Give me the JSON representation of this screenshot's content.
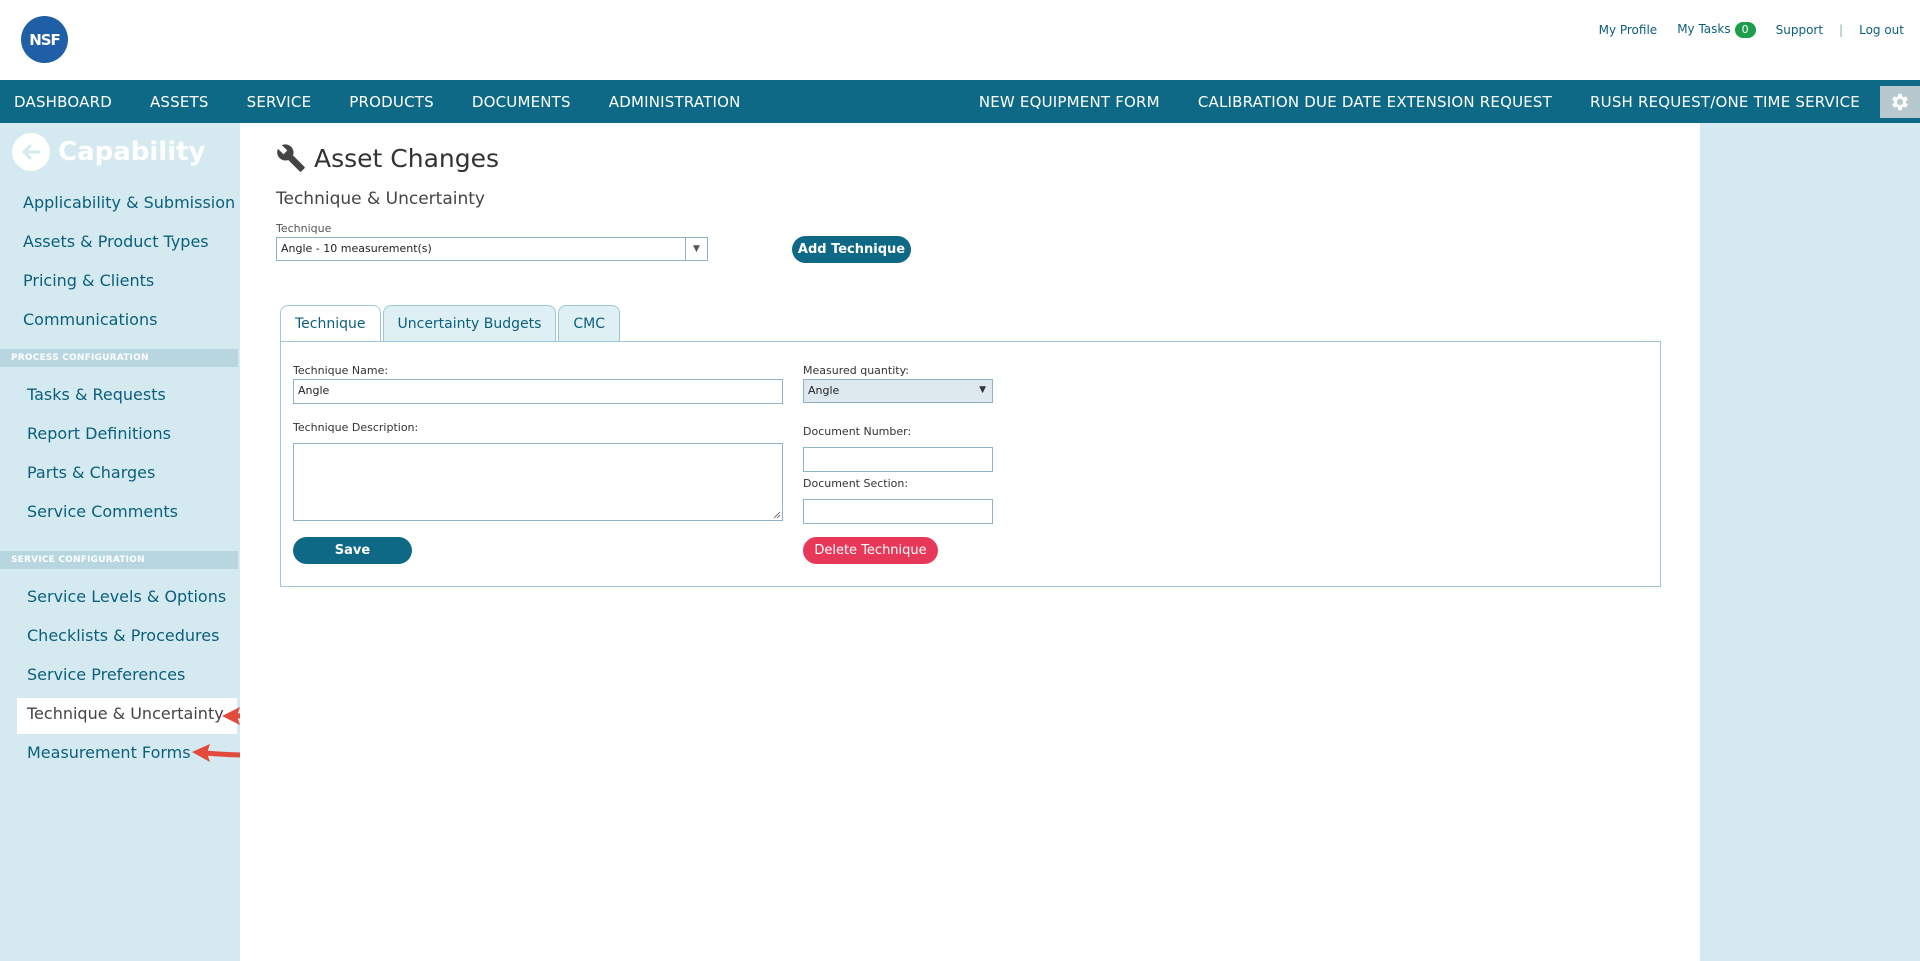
{
  "brand": {
    "logo_text": "NSF"
  },
  "top_links": {
    "my_profile": "My Profile",
    "my_tasks": "My Tasks",
    "tasks_count": "0",
    "support": "Support",
    "separator": "|",
    "log_out": "Log out"
  },
  "nav": {
    "left": [
      "DASHBOARD",
      "ASSETS",
      "SERVICE",
      "PRODUCTS",
      "DOCUMENTS",
      "ADMINISTRATION"
    ],
    "right": [
      "NEW EQUIPMENT FORM",
      "CALIBRATION DUE DATE EXTENSION REQUEST",
      "RUSH REQUEST/ONE TIME SERVICE"
    ],
    "gear_icon": "gear-icon"
  },
  "sidebar": {
    "title": "Capability",
    "group1": [
      "Applicability & Submission",
      "Assets & Product Types",
      "Pricing & Clients",
      "Communications"
    ],
    "section_process": "PROCESS CONFIGURATION",
    "group2": [
      "Tasks & Requests",
      "Report Definitions",
      "Parts & Charges",
      "Service Comments"
    ],
    "section_service": "SERVICE CONFIGURATION",
    "group3": [
      "Service Levels & Options",
      "Checklists & Procedures",
      "Service Preferences",
      "Technique & Uncertainty",
      "Measurement Forms"
    ],
    "active_item": "Technique & Uncertainty"
  },
  "main": {
    "title": "Asset Changes",
    "title_icon": "wrench-icon",
    "subtitle": "Technique & Uncertainty",
    "technique_label": "Technique",
    "technique_value": "Angle - 10 measurement(s)",
    "add_technique": "Add Technique",
    "tabs": [
      "Technique",
      "Uncertainty Budgets",
      "CMC"
    ],
    "active_tab": "Technique",
    "form": {
      "name_label": "Technique Name:",
      "name_value": "Angle",
      "desc_label": "Technique Description:",
      "desc_value": "",
      "mq_label": "Measured quantity:",
      "mq_value": "Angle",
      "doc_num_label": "Document Number:",
      "doc_num_value": "",
      "doc_sec_label": "Document Section:",
      "doc_sec_value": "",
      "save": "Save",
      "delete": "Delete Technique"
    }
  },
  "colors": {
    "nav_bg": "#0d6985",
    "sidebar_bg": "#d4eaf0",
    "accent": "#0b5f7d",
    "danger": "#e8385a",
    "annotation_arrow": "#e24a3b"
  }
}
